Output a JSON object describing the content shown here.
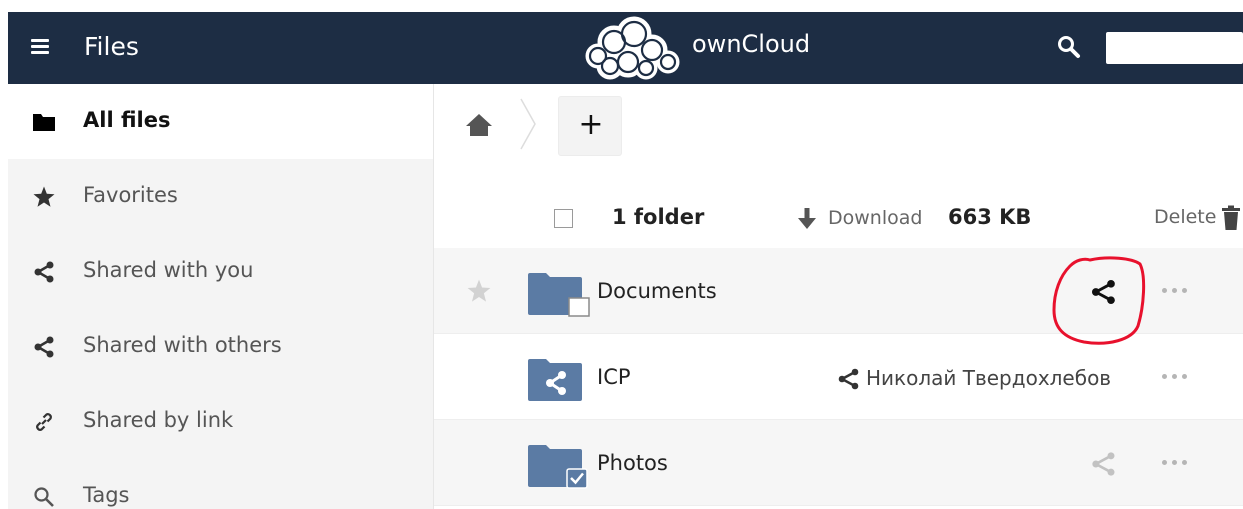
{
  "header": {
    "app_title": "Files",
    "brand_name": "ownCloud",
    "menu_icon": "hamburger-menu-icon",
    "search_icon": "search-icon",
    "user_name": "",
    "background_color": "#1d2d44"
  },
  "sidebar": {
    "items": [
      {
        "label": "All files",
        "icon": "folder-icon",
        "active": true
      },
      {
        "label": "Favorites",
        "icon": "star-icon",
        "active": false
      },
      {
        "label": "Shared with you",
        "icon": "share-icon",
        "active": false
      },
      {
        "label": "Shared with others",
        "icon": "share-icon",
        "active": false
      },
      {
        "label": "Shared by link",
        "icon": "link-icon",
        "active": false
      },
      {
        "label": "Tags",
        "icon": "search-icon",
        "active": false
      }
    ]
  },
  "toolbar": {
    "home_icon": "home-icon",
    "new_button_label": "+"
  },
  "list_header": {
    "count_label": "1 folder",
    "download_label": "Download",
    "total_size": "663 KB",
    "delete_label": "Delete"
  },
  "files": [
    {
      "name": "Documents",
      "icon": "folder-icon",
      "share_state": "share-icon",
      "shared_with": "",
      "highlighted": true
    },
    {
      "name": "ICP",
      "icon": "shared-folder-icon",
      "share_state": "shared",
      "shared_with": "Николай Твердохлебов",
      "highlighted": false
    },
    {
      "name": "Photos",
      "icon": "folder-checked-icon",
      "share_state": "share-icon",
      "shared_with": "",
      "highlighted": true
    }
  ],
  "colors": {
    "folder": "#5b7ba4",
    "annotation": "#e8112d"
  }
}
